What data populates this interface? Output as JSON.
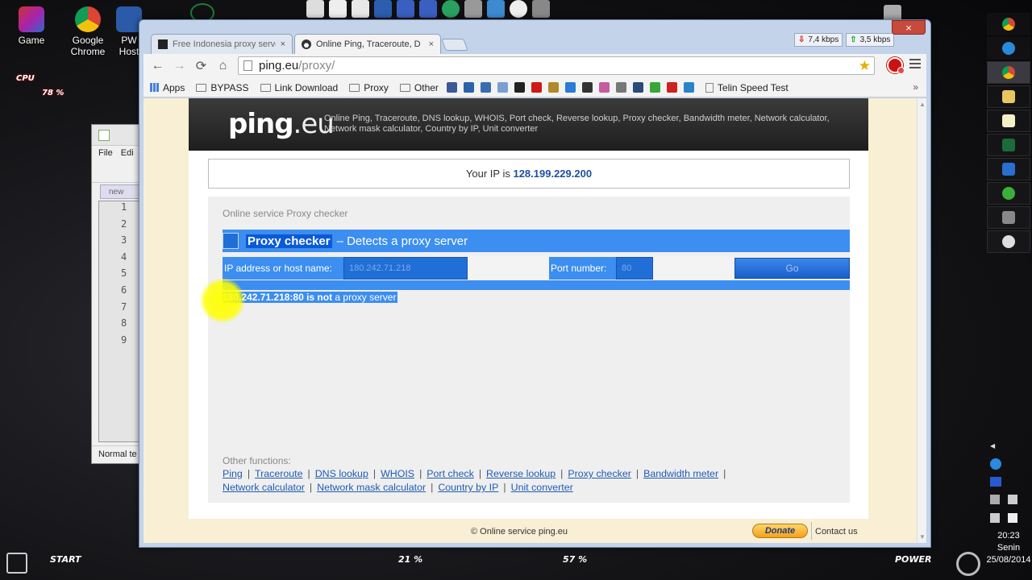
{
  "desktop": {
    "icons": [
      {
        "label": "Game"
      },
      {
        "label": "Google\nChrome"
      },
      {
        "label": "PW\nHost"
      }
    ],
    "cpu_label": "CPU",
    "cpu_value": "78 %",
    "taskbar": {
      "start_label": "START",
      "mid1": "21 %",
      "mid2": "57 %",
      "power_label": "POWER"
    },
    "clock": {
      "time": "20:23",
      "day": "Senin",
      "date": "25/08/2014"
    }
  },
  "notepad": {
    "menu_file": "File",
    "menu_edit": "Edi",
    "tab_label": "new",
    "line_numbers": [
      "1",
      "2",
      "3",
      "4",
      "5",
      "6",
      "7",
      "8",
      "9"
    ],
    "status": "Normal te"
  },
  "browser": {
    "tabs": [
      {
        "label": "Free Indonesia proxy serve",
        "close": "×",
        "favicon_color": "#222222"
      },
      {
        "label": "Online Ping, Traceroute, D",
        "close": "×",
        "favicon_color": "#333333"
      }
    ],
    "netmon": {
      "down": "7,4 kbps",
      "up": "3,5 kbps"
    },
    "close_glyph": "×",
    "nav": {
      "back": "←",
      "forward": "→",
      "reload": "⟳",
      "home": "⌂"
    },
    "url": {
      "host": "ping.eu",
      "path": "/proxy/"
    },
    "star": "★",
    "bookmarks": [
      {
        "label": "Apps",
        "kind": "apps"
      },
      {
        "label": "BYPASS",
        "kind": "folder"
      },
      {
        "label": "Link Download",
        "kind": "folder"
      },
      {
        "label": "Proxy",
        "kind": "folder"
      },
      {
        "label": "Other",
        "kind": "folder"
      }
    ],
    "bookmark_icons": [
      {
        "name": "facebook-icon",
        "color": "#3b5998"
      },
      {
        "name": "bookmark-icon-2",
        "color": "#2b62a8"
      },
      {
        "name": "settings-icon",
        "color": "#3a6db0"
      },
      {
        "name": "mail-icon",
        "color": "#7aa0d0"
      },
      {
        "name": "circle-icon",
        "color": "#222222"
      },
      {
        "name": "youtube-icon",
        "color": "#d01818"
      },
      {
        "name": "shield-icon",
        "color": "#b08a2a"
      },
      {
        "name": "four-icon",
        "color": "#2c7bd4"
      },
      {
        "name": "fire-icon",
        "color": "#333333"
      },
      {
        "name": "flower-icon",
        "color": "#c85aa0"
      },
      {
        "name": "face-icon",
        "color": "#777777"
      },
      {
        "name": "s-icon",
        "color": "#2a4a7a"
      },
      {
        "name": "download-icon",
        "color": "#3aa63a"
      },
      {
        "name": "red-icon",
        "color": "#cc2222"
      },
      {
        "name": "send-icon",
        "color": "#2a82c8"
      }
    ],
    "bookmark_last": "Telin Speed Test",
    "more": "»"
  },
  "page": {
    "logo_main": "ping",
    "logo_ext": ".eu",
    "tagline": "Online Ping, Traceroute, DNS lookup, WHOIS, Port check, Reverse lookup, Proxy checker, Bandwidth meter, Network calculator, Network mask calculator, Country by IP, Unit converter",
    "ip_label": "Your IP is",
    "ip_value": "128.199.229.200",
    "crumb": "Online service Proxy checker",
    "title_main": "Proxy checker",
    "title_sub": "– Detects a proxy server",
    "form": {
      "ip_label": "IP address or host name:",
      "ip_value": "180.242.71.218",
      "port_label": "Port number:",
      "port_value": "80",
      "go": "Go"
    },
    "result_bold": "180.242.71.218:80 is not",
    "result_rest": " a proxy server",
    "other_label": "Other functions:",
    "links_row1": [
      "Ping",
      "Traceroute",
      "DNS lookup",
      "WHOIS",
      "Port check",
      "Reverse lookup",
      "Proxy checker",
      "Bandwidth meter"
    ],
    "links_row2": [
      "Network calculator",
      "Network mask calculator",
      "Country by IP",
      "Unit converter"
    ],
    "sep": "|",
    "footer_copy": "© Online service ping.eu",
    "donate": "Donate",
    "contact": "Contact us"
  },
  "colors": {
    "accent_blue": "#3c8ef0",
    "ip_blue": "#1f4fa0",
    "link_blue": "#1f5bb5",
    "header_dark": "#2a2a2a",
    "page_bg": "#f8efd4"
  }
}
